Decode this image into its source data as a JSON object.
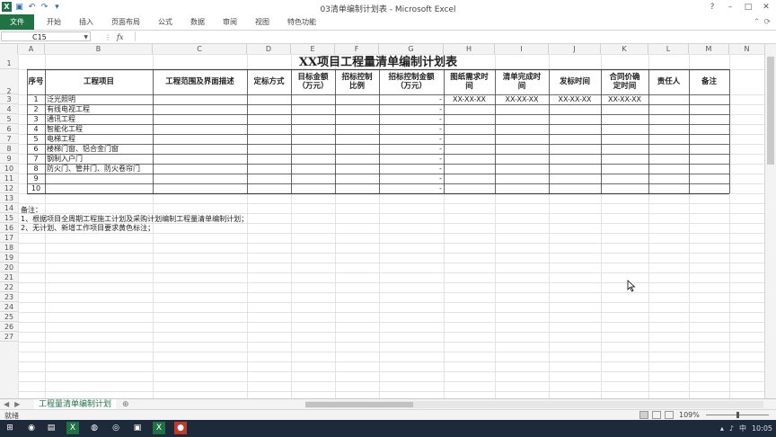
{
  "window": {
    "title": "03清单编制计划表 - Microsoft Excel",
    "win_min": "–",
    "win_max": "□",
    "win_close": "✕"
  },
  "ribbon": {
    "file": "文件",
    "tabs": [
      "开始",
      "插入",
      "页面布局",
      "公式",
      "数据",
      "审阅",
      "视图",
      "特色功能"
    ]
  },
  "formula_bar": {
    "name_box": "C15",
    "fx": "fx",
    "content": ""
  },
  "columns": [
    "A",
    "B",
    "C",
    "D",
    "E",
    "F",
    "G",
    "H",
    "I",
    "J",
    "K",
    "L",
    "M",
    "N"
  ],
  "rows": [
    "1",
    "2",
    "3",
    "4",
    "5",
    "6",
    "7",
    "8",
    "9",
    "10",
    "11",
    "12",
    "13",
    "14",
    "15",
    "16",
    "17",
    "18",
    "19",
    "20",
    "21",
    "22",
    "23",
    "24",
    "25",
    "26",
    "27"
  ],
  "sheet": {
    "title": "XX项目工程量清单编制计划表",
    "headers": [
      "序号",
      "工程项目",
      "工程范围及界面描述",
      "定标方式",
      "目标金额\n（万元）",
      "招标控制\n比例",
      "招标控制金额\n（万元）",
      "图纸需求时\n间",
      "清单完成时\n间",
      "发标时间",
      "合同价确\n定时间",
      "责任人",
      "备注"
    ],
    "rows": [
      {
        "no": "1",
        "item": "泛光照明",
        "amount": "-",
        "drawing": "XX-XX-XX",
        "list": "XX-XX-XX",
        "bid": "XX-XX-XX",
        "contract": "XX-XX-XX"
      },
      {
        "no": "2",
        "item": "有线电视工程",
        "amount": "-",
        "drawing": "",
        "list": "",
        "bid": "",
        "contract": ""
      },
      {
        "no": "3",
        "item": "通讯工程",
        "amount": "-",
        "drawing": "",
        "list": "",
        "bid": "",
        "contract": ""
      },
      {
        "no": "4",
        "item": "智能化工程",
        "amount": "-",
        "drawing": "",
        "list": "",
        "bid": "",
        "contract": ""
      },
      {
        "no": "5",
        "item": "电梯工程",
        "amount": "-",
        "drawing": "",
        "list": "",
        "bid": "",
        "contract": ""
      },
      {
        "no": "6",
        "item": "楼梯门窗、铝合金门窗",
        "amount": "-",
        "drawing": "",
        "list": "",
        "bid": "",
        "contract": ""
      },
      {
        "no": "7",
        "item": "钢制入户门",
        "amount": "-",
        "drawing": "",
        "list": "",
        "bid": "",
        "contract": ""
      },
      {
        "no": "8",
        "item": "防火门、管井门、防火卷帘门",
        "amount": "-",
        "drawing": "",
        "list": "",
        "bid": "",
        "contract": ""
      },
      {
        "no": "9",
        "item": "",
        "amount": "-",
        "drawing": "",
        "list": "",
        "bid": "",
        "contract": ""
      },
      {
        "no": "10",
        "item": "",
        "amount": "-",
        "drawing": "",
        "list": "",
        "bid": "",
        "contract": ""
      }
    ],
    "notes": [
      "备注：",
      "1、根据项目全周期工程施工计划及采购计划编制工程量清单编制计划；",
      "2、无计划、新增工作项目要求黄色标注；"
    ]
  },
  "sheet_tabs": {
    "active": "工程量清单编制计划",
    "add": "⊕",
    "nav_first": "◀",
    "nav_last": "▶"
  },
  "status": {
    "ready": "就绪",
    "zoom": "109%"
  },
  "taskbar": {
    "time": "10:05",
    "ime": "中"
  },
  "colors": {
    "excel_green": "#217346",
    "taskbar": "#1c2a3a"
  }
}
